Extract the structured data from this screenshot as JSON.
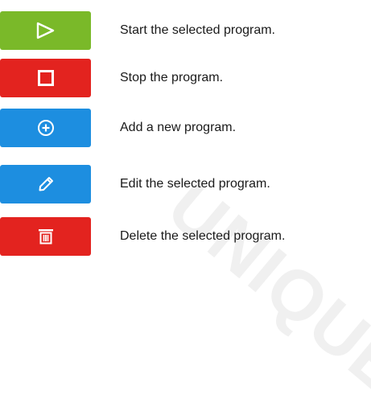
{
  "watermark": {
    "text": "UNIQUE",
    "color": "#f0f0f0"
  },
  "buttons": [
    {
      "icon": "play-icon",
      "color": "#7ab929",
      "label": "Start the selected program."
    },
    {
      "icon": "stop-icon",
      "color": "#e3231f",
      "label": "Stop the program."
    },
    {
      "icon": "add-circle-icon",
      "color": "#1d8ee0",
      "label": "Add a new program."
    },
    {
      "icon": "pencil-icon",
      "color": "#1d8ee0",
      "label": "Edit the selected program."
    },
    {
      "icon": "trash-icon",
      "color": "#e3231f",
      "label": "Delete the selected program."
    }
  ]
}
